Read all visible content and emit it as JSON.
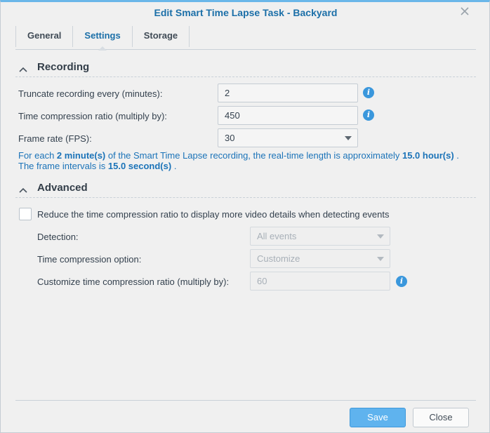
{
  "dialog": {
    "title": "Edit Smart Time Lapse Task - Backyard"
  },
  "tabs": [
    {
      "label": "General"
    },
    {
      "label": "Settings"
    },
    {
      "label": "Storage"
    }
  ],
  "recording": {
    "heading": "Recording",
    "truncate_label": "Truncate recording every (minutes):",
    "truncate_value": "2",
    "compression_label": "Time compression ratio (multiply by):",
    "compression_value": "450",
    "framerate_label": "Frame rate (FPS):",
    "framerate_value": "30",
    "note": {
      "p1": "For each ",
      "b1": "2 minute(s)",
      "p2": " of the Smart Time Lapse recording, the real-time length is approximately ",
      "b2": "15.0 hour(s)",
      "p3": " . The frame intervals is ",
      "b3": "15.0 second(s)",
      "p4": " ."
    }
  },
  "advanced": {
    "heading": "Advanced",
    "reduce_label": "Reduce the time compression ratio to display more video details when detecting events",
    "reduce_checked": false,
    "detection_label": "Detection:",
    "detection_value": "All events",
    "option_label": "Time compression option:",
    "option_value": "Customize",
    "custom_label": "Customize time compression ratio (multiply by):",
    "custom_value": "60"
  },
  "footer": {
    "save_label": "Save",
    "close_label": "Close"
  },
  "colors": {
    "accent": "#1b6fa8",
    "info_icon": "#3a97dc",
    "primary_button": "#5fb3ee"
  },
  "icons": {
    "close": "close-icon",
    "collapse": "chevron-up-icon",
    "info": "info-icon",
    "dropdown": "chevron-down-icon"
  }
}
